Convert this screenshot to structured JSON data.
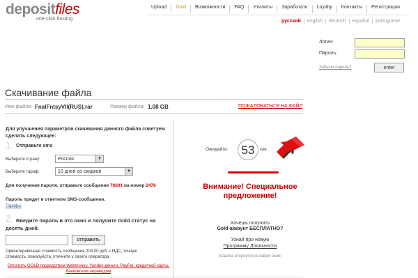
{
  "header": {
    "logo_main": "deposit",
    "logo_accent": "files",
    "tagline": "one-click hosting",
    "nav": [
      "Upload",
      "Gold",
      "Возможности",
      "FAQ",
      "Утилиты",
      "Заработать",
      "Loyalty",
      "Контакты",
      "Регистрация"
    ],
    "languages": [
      "русский",
      "english",
      "deutsch",
      "español",
      "portuguese"
    ]
  },
  "login": {
    "login_label": "Логин:",
    "password_label": "Пароль:",
    "forgot": "Забыли пароль?",
    "enter": "enter"
  },
  "main": {
    "title": "Скачивание файла",
    "filename_label": "Имя файла:",
    "filename": "FnalFntsyVII(RUS).rar",
    "size_label": "Размер файла:",
    "size": "1.08 GB",
    "complain": "ПОЖАЛОВАТЬСЯ НА ФАЙЛ"
  },
  "sms": {
    "intro": "Для улучшения параметров скачивания данного файла советуем сделать следующее:",
    "step1_num": "1.",
    "step1_title": "Отправьте sms",
    "country_label": "Выберите страну:",
    "country": "Россия",
    "tariff_label": "Выберите тариф:",
    "tariff": "10 дней со скидкой",
    "send_text_1": "Для получения пароля, отправьте сообщение",
    "code": "76601",
    "send_text_2": "на номер",
    "number": "2476",
    "reply_text": "Пароль придет в ответном SMS-сообщении.",
    "tariffs_link": "Тарифы",
    "step2_num": "2.",
    "step2_title": "Введите пароль в это окно и получите Gold статус на десять дней.",
    "send_button": "отправить",
    "cost_text": "Ориентировочная стоимость сообщения 203.00 руб. с НДС, точную стоимость, пожалуйста, уточните у своего оператора.",
    "pay_link": "Оплатить GOLD посредством Webmoney, Yandex-деньги, PayPal, кредитной карты, банковским переводом"
  },
  "wait": {
    "label": "Ожидайте:",
    "seconds": "53",
    "unit": "сек."
  },
  "offer": {
    "attention": "Внимание! Специальное предложение!",
    "want": "Хочешь получить",
    "gold_free": "Gold-аккаунт БЕСПЛАТНО?",
    "learn": "Узнай про новую",
    "program": "Программу Лояльности",
    "note": "(ссылка откроется в новом окне)"
  }
}
